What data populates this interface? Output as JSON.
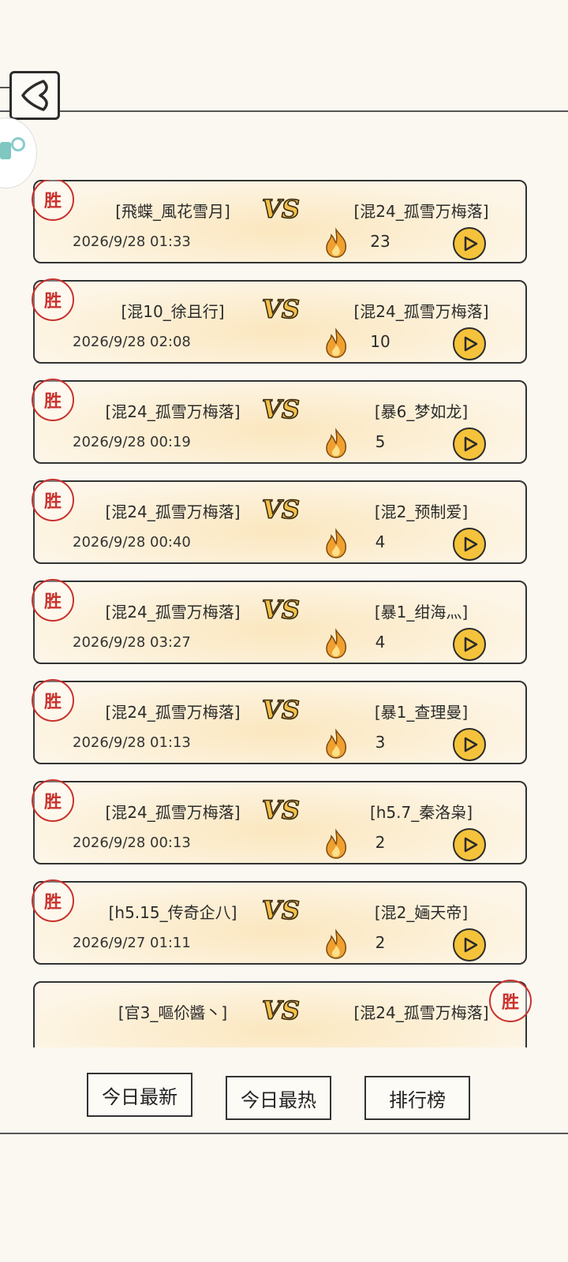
{
  "header": {
    "back_icon": "chevron-left-icon"
  },
  "colors": {
    "seal": "#c9322e",
    "vs": "#e3a62a",
    "fire": "#f0a030",
    "play": "#f5c33b"
  },
  "win_label": "胜",
  "matches": [
    {
      "left": "[飛蝶_風花雪月]",
      "right": "[混24_孤雪万梅落]",
      "date": "2026/9/28 01:33",
      "heat": "23",
      "winner": "left"
    },
    {
      "left": "[混10_徐且行]",
      "right": "[混24_孤雪万梅落]",
      "date": "2026/9/28 02:08",
      "heat": "10",
      "winner": "left"
    },
    {
      "left": "[混24_孤雪万梅落]",
      "right": "[暴6_梦如龙]",
      "date": "2026/9/28 00:19",
      "heat": "5",
      "winner": "left"
    },
    {
      "left": "[混24_孤雪万梅落]",
      "right": "[混2_预制爱]",
      "date": "2026/9/28 00:40",
      "heat": "4",
      "winner": "left"
    },
    {
      "left": "[混24_孤雪万梅落]",
      "right": "[暴1_绀海灬]",
      "date": "2026/9/28 03:27",
      "heat": "4",
      "winner": "left"
    },
    {
      "left": "[混24_孤雪万梅落]",
      "right": "[暴1_查理曼]",
      "date": "2026/9/28 01:13",
      "heat": "3",
      "winner": "left"
    },
    {
      "left": "[混24_孤雪万梅落]",
      "right": "[h5.7_秦洛枭]",
      "date": "2026/9/28 00:13",
      "heat": "2",
      "winner": "left"
    },
    {
      "left": "[h5.15_传奇企八]",
      "right": "[混2_婳天帝]",
      "date": "2026/9/27 01:11",
      "heat": "2",
      "winner": "left"
    },
    {
      "left": "[官3_嘔伱醬丶]",
      "right": "[混24_孤雪万梅落]",
      "date": "",
      "heat": "",
      "winner": "right"
    }
  ],
  "tabs": {
    "newest": "今日最新",
    "hottest": "今日最热",
    "ranking": "排行榜"
  }
}
